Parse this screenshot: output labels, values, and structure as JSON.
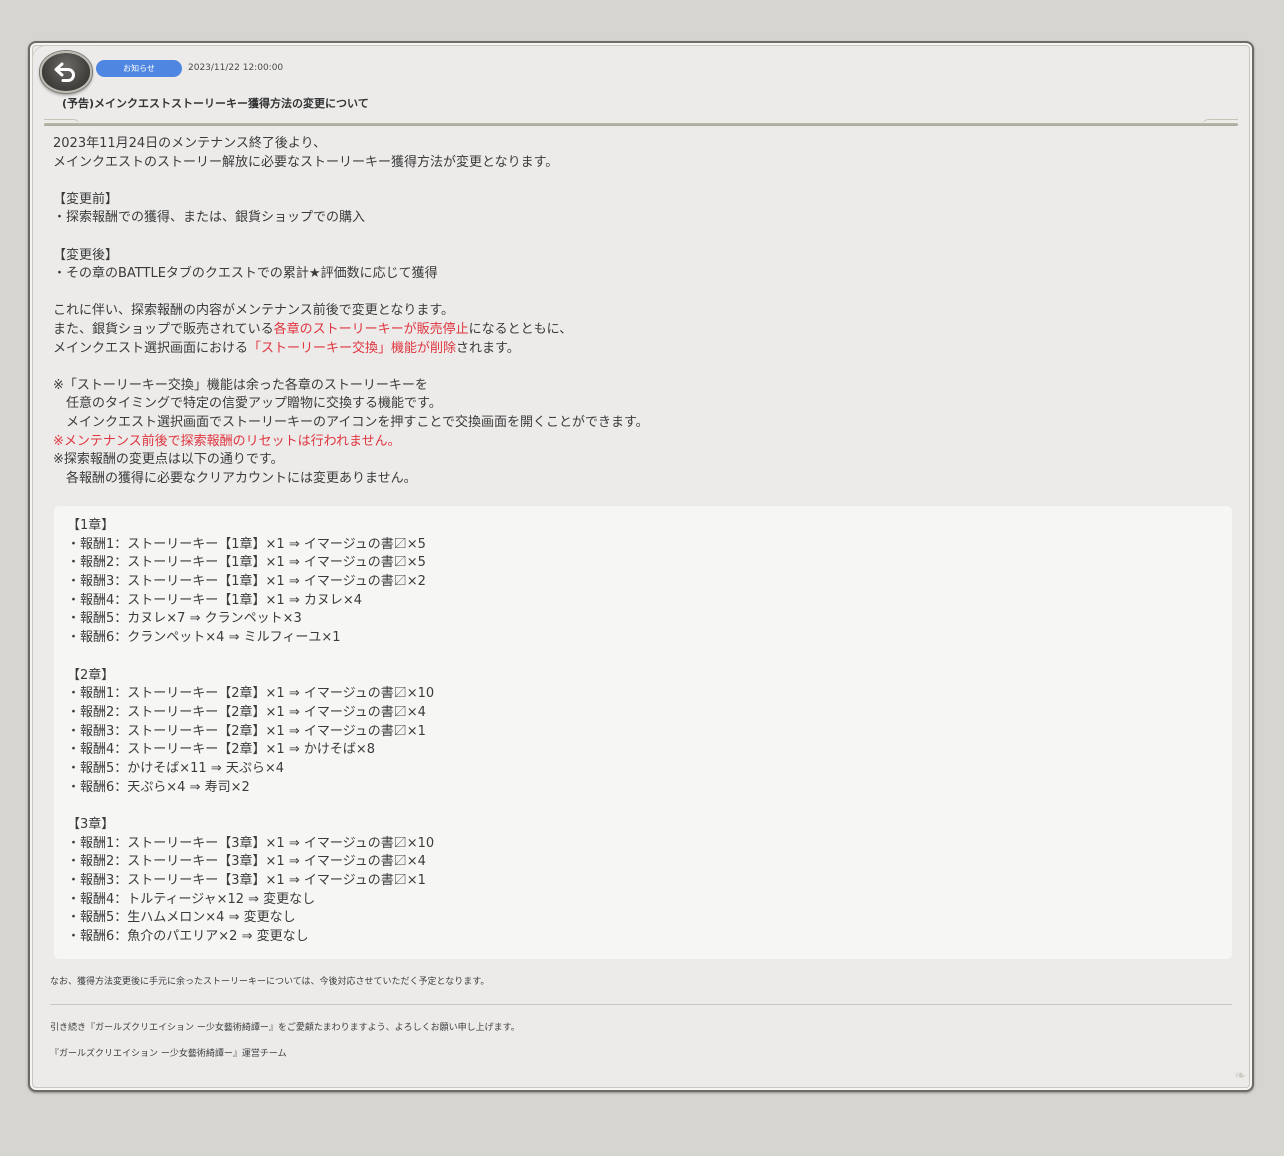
{
  "header": {
    "badge": "お知らせ",
    "timestamp": "2023/11/22 12:00:00",
    "title": "(予告)メインクエストストーリーキー獲得方法の変更について"
  },
  "icons": {
    "back": "back-arrow-icon"
  },
  "colors": {
    "badge": "#4f86e2",
    "highlight": "#e0353f"
  },
  "body": {
    "l1": "2023年11月24日のメンテナンス終了後より、",
    "l2": "メインクエストのストーリー解放に必要なストーリーキー獲得方法が変更となります。",
    "before_head": "【変更前】",
    "before_item": "・探索報酬での獲得、または、銀貨ショップでの購入",
    "after_head": "【変更後】",
    "after_item": "・その章のBATTLEタブのクエストでの累計★評価数に応じて獲得",
    "p1": "これに伴い、探索報酬の内容がメンテナンス前後で変更となります。",
    "p2_a": "また、銀貨ショップで販売されている",
    "p2_red": "各章のストーリーキーが販売停止",
    "p2_b": "になるとともに、",
    "p3_a": "メインクエスト選択画面における",
    "p3_red": "「ストーリーキー交換」機能が削除",
    "p3_b": "されます。",
    "n1": "※「ストーリーキー交換」機能は余った各章のストーリーキーを",
    "n2": "　任意のタイミングで特定の信愛アップ贈物に交換する機能です。",
    "n3": "　メインクエスト選択画面でストーリーキーのアイコンを押すことで交換画面を開くことができます。",
    "n4_mark": "※",
    "n4_red": "メンテナンス前後で探索報酬のリセットは行われません。",
    "n5": "※探索報酬の変更点は以下の通りです。",
    "n6": "　各報酬の獲得に必要なクリアカウントには変更ありません。"
  },
  "rewards": {
    "ch1": {
      "head": "【1章】",
      "items": [
        "・報酬1：ストーリーキー【1章】×1 ⇒ イマージュの書〼×5",
        "・報酬2：ストーリーキー【1章】×1 ⇒ イマージュの書〼×5",
        "・報酬3：ストーリーキー【1章】×1 ⇒ イマージュの書〼×2",
        "・報酬4：ストーリーキー【1章】×1 ⇒ カヌレ×4",
        "・報酬5：カヌレ×7 ⇒ クランペット×3",
        "・報酬6：クランペット×4 ⇒ ミルフィーユ×1"
      ]
    },
    "ch2": {
      "head": "【2章】",
      "items": [
        "・報酬1：ストーリーキー【2章】×1 ⇒ イマージュの書〼×10",
        "・報酬2：ストーリーキー【2章】×1 ⇒ イマージュの書〼×4",
        "・報酬3：ストーリーキー【2章】×1 ⇒ イマージュの書〼×1",
        "・報酬4：ストーリーキー【2章】×1 ⇒ かけそば×8",
        "・報酬5：かけそば×11 ⇒ 天ぷら×4",
        "・報酬6：天ぷら×4 ⇒ 寿司×2"
      ]
    },
    "ch3": {
      "head": "【3章】",
      "items": [
        "・報酬1：ストーリーキー【3章】×1 ⇒ イマージュの書〼×10",
        "・報酬2：ストーリーキー【3章】×1 ⇒ イマージュの書〼×4",
        "・報酬3：ストーリーキー【3章】×1 ⇒ イマージュの書〼×1",
        "・報酬4：トルティージャ×12 ⇒ 変更なし",
        "・報酬5：生ハムメロン×4 ⇒ 変更なし",
        "・報酬6：魚介のパエリア×2 ⇒ 変更なし"
      ]
    }
  },
  "footer": {
    "note": "なお、獲得方法変更後に手元に余ったストーリーキーについては、今後対応させていただく予定となります。",
    "closing": "引き続き『ガールズクリエイション ー少女藝術綺譚ー』をご愛顧たまわりますよう、よろしくお願い申し上げます。",
    "sign": "『ガールズクリエイション ー少女藝術綺譚ー』運営チーム"
  }
}
